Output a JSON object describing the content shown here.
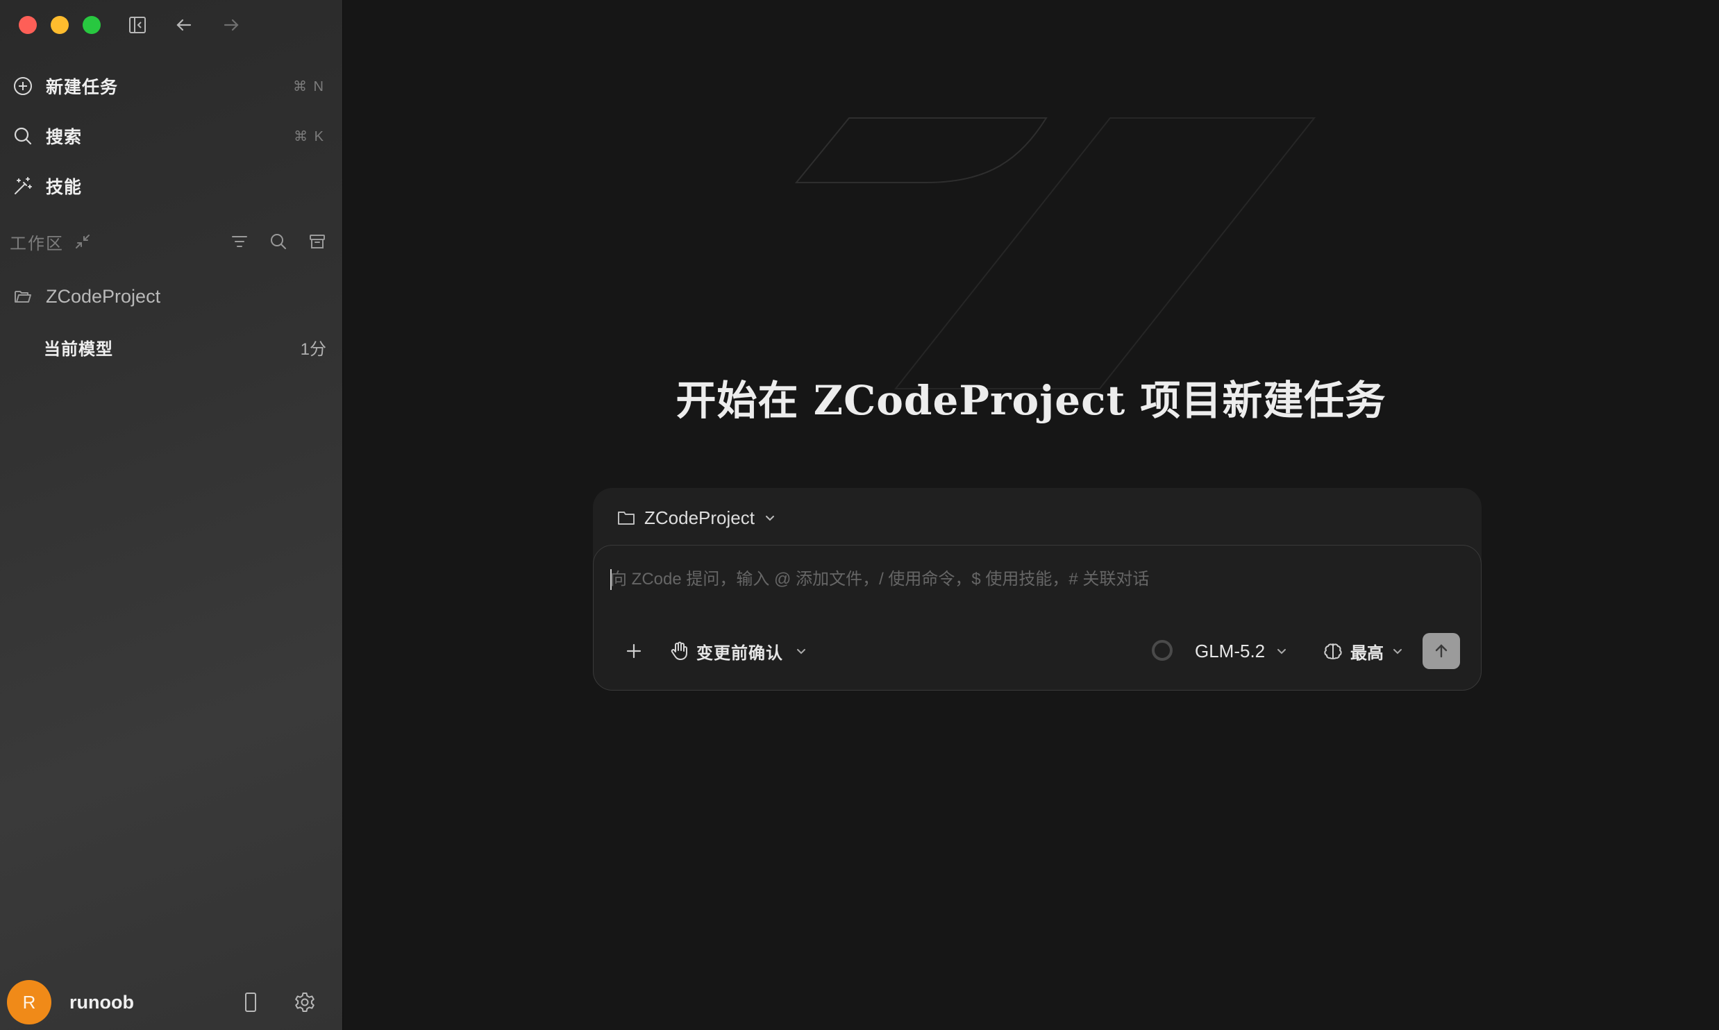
{
  "sidebar": {
    "nav": [
      {
        "label": "新建任务",
        "shortcut": "⌘ N",
        "icon": "plus-circle-icon"
      },
      {
        "label": "搜索",
        "shortcut": "⌘ K",
        "icon": "search-icon"
      },
      {
        "label": "技能",
        "shortcut": "",
        "icon": "magic-wand-icon"
      }
    ],
    "workspace": {
      "title": "工作区",
      "project": "ZCodeProject",
      "tasks": [
        {
          "label": "当前模型",
          "time": "1分"
        }
      ]
    },
    "user": {
      "avatar_initial": "R",
      "name": "runoob",
      "avatar_color": "#f08a18"
    }
  },
  "main": {
    "title": "开始在 ZCodeProject 项目新建任务",
    "composer": {
      "project": "ZCodeProject",
      "placeholder": "向 ZCode 提问，输入 @ 添加文件，/ 使用命令，$ 使用技能，# 关联对话",
      "value": "",
      "approval_mode": "变更前确认",
      "model": "GLM-5.2",
      "effort": "最高"
    }
  },
  "colors": {
    "close": "#fe5f57",
    "minimize": "#febc2e",
    "zoom": "#28c840",
    "background": "#161616",
    "sidebar": "#313131"
  }
}
